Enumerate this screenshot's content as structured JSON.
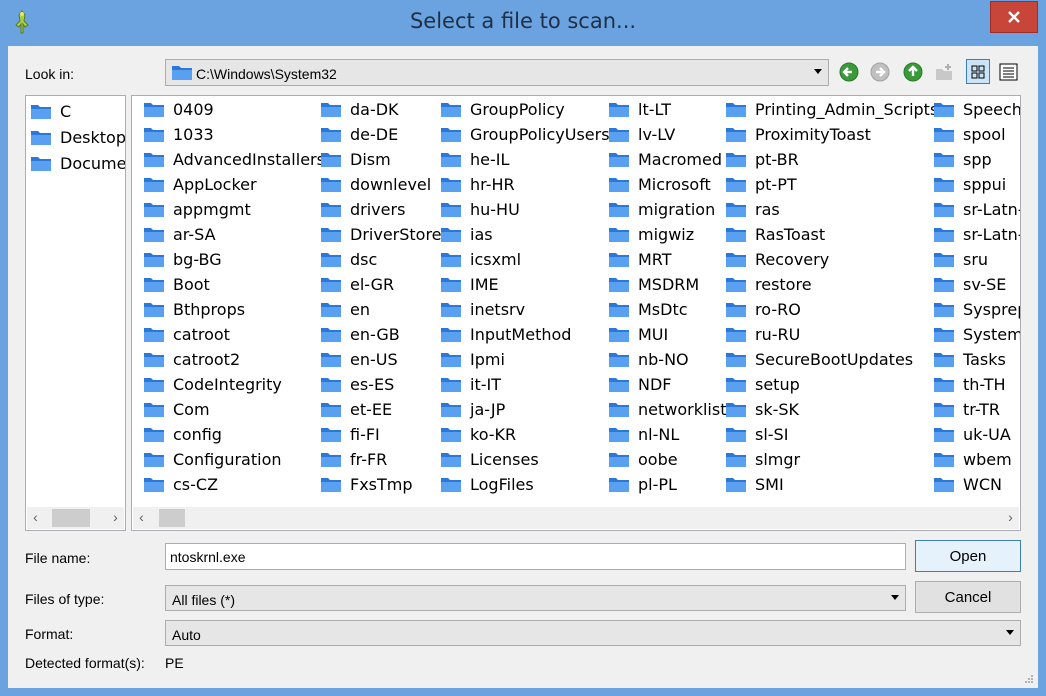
{
  "window": {
    "title": "Select a file to scan..."
  },
  "look_in": {
    "label": "Look in:",
    "path": "C:\\Windows\\System32"
  },
  "toolbar": {
    "back_icon": "back-arrow-icon",
    "forward_icon": "forward-arrow-icon",
    "up_icon": "up-arrow-icon",
    "new_folder_icon": "new-folder-icon",
    "list_view_icon": "list-view-icon",
    "detail_view_icon": "detail-view-icon"
  },
  "sidebar": {
    "items": [
      "C",
      "Desktop",
      "Docume"
    ]
  },
  "folders": {
    "col1": [
      "0409",
      "1033",
      "AdvancedInstallers",
      "AppLocker",
      "appmgmt",
      "ar-SA",
      "bg-BG",
      "Boot",
      "Bthprops",
      "catroot",
      "catroot2",
      "CodeIntegrity",
      "Com",
      "config",
      "Configuration",
      "cs-CZ"
    ],
    "col2": [
      "da-DK",
      "de-DE",
      "Dism",
      "downlevel",
      "drivers",
      "DriverStore",
      "dsc",
      "el-GR",
      "en",
      "en-GB",
      "en-US",
      "es-ES",
      "et-EE",
      "fi-FI",
      "fr-FR",
      "FxsTmp"
    ],
    "col3": [
      "GroupPolicy",
      "GroupPolicyUsers",
      "he-IL",
      "hr-HR",
      "hu-HU",
      "ias",
      "icsxml",
      "IME",
      "inetsrv",
      "InputMethod",
      "Ipmi",
      "it-IT",
      "ja-JP",
      "ko-KR",
      "Licenses",
      "LogFiles"
    ],
    "col4": [
      "lt-LT",
      "lv-LV",
      "Macromed",
      "Microsoft",
      "migration",
      "migwiz",
      "MRT",
      "MSDRM",
      "MsDtc",
      "MUI",
      "nb-NO",
      "NDF",
      "networklist",
      "nl-NL",
      "oobe",
      "pl-PL"
    ],
    "col5": [
      "Printing_Admin_Scripts",
      "ProximityToast",
      "pt-BR",
      "pt-PT",
      "ras",
      "RasToast",
      "Recovery",
      "restore",
      "ro-RO",
      "ru-RU",
      "SecureBootUpdates",
      "setup",
      "sk-SK",
      "sl-SI",
      "slmgr",
      "SMI"
    ],
    "col6": [
      "Speech",
      "spool",
      "spp",
      "sppui",
      "sr-Latn-",
      "sr-Latn-",
      "sru",
      "sv-SE",
      "Sysprep",
      "SystemR",
      "Tasks",
      "th-TH",
      "tr-TR",
      "uk-UA",
      "wbem",
      "WCN"
    ]
  },
  "scroll_left": "‹",
  "scroll_right": "›",
  "file_name": {
    "label": "File name:",
    "value": "ntoskrnl.exe"
  },
  "file_type": {
    "label": "Files of type:",
    "value": "All files (*)"
  },
  "format": {
    "label": "Format:",
    "value": "Auto"
  },
  "detected": {
    "label": "Detected format(s):",
    "value": "PE"
  },
  "buttons": {
    "open": "Open",
    "cancel": "Cancel"
  }
}
